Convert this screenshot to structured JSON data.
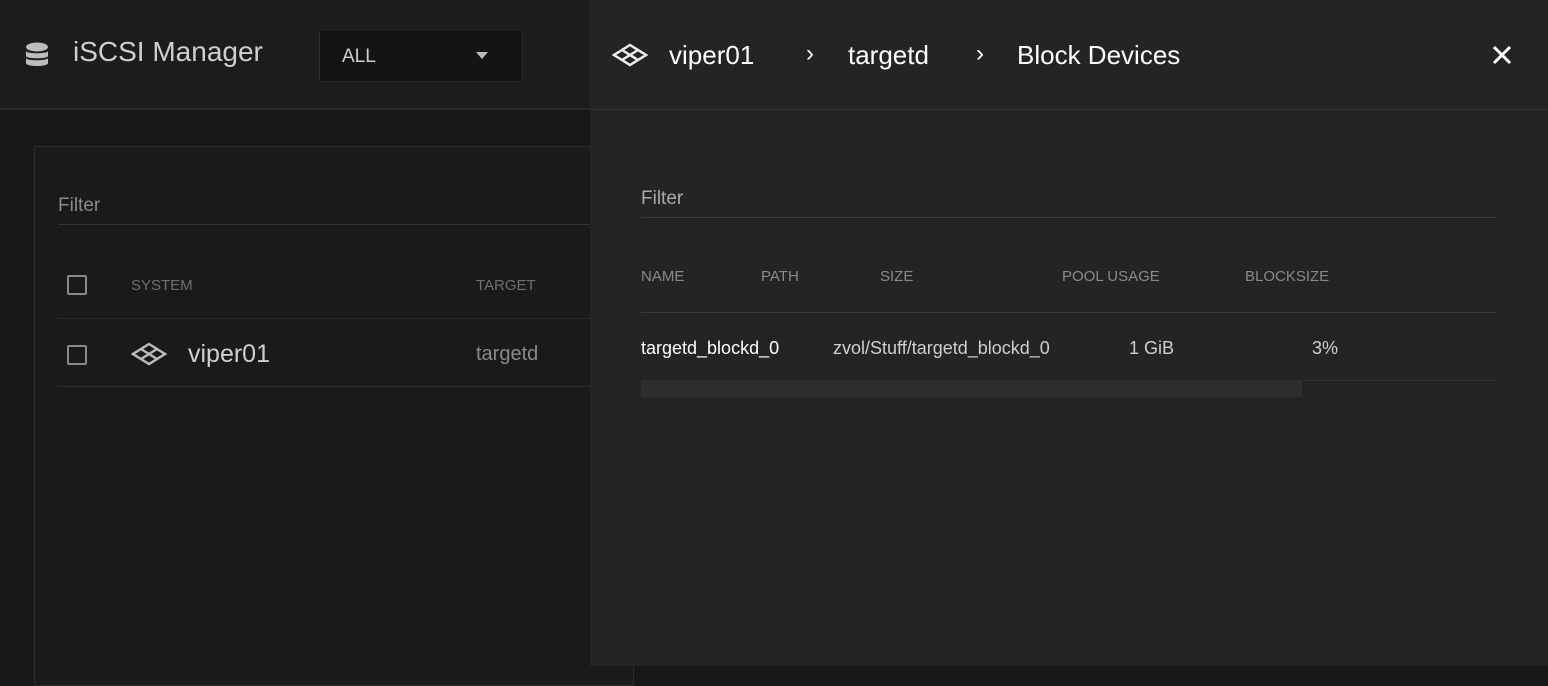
{
  "header": {
    "app_title": "iSCSI Manager",
    "app_icon": "database-icon",
    "system_select": {
      "value": "ALL"
    }
  },
  "list": {
    "filter_placeholder": "Filter",
    "columns": [
      "SYSTEM",
      "TARGET"
    ],
    "rows": [
      {
        "system": "viper01",
        "system_icon": "server-grid-icon",
        "target": "targetd"
      }
    ]
  },
  "panel": {
    "breadcrumb": [
      "viper01",
      "targetd",
      "Block Devices"
    ],
    "close_icon": "close-icon",
    "filter_placeholder": "Filter",
    "columns": [
      "NAME",
      "PATH",
      "SIZE",
      "POOL USAGE",
      "BLOCKSIZE"
    ],
    "rows": [
      {
        "name": "targetd_blockd_0",
        "path": "zvol/Stuff/targetd_blockd_0",
        "size": "1 GiB",
        "pool_usage": "3%",
        "blocksize": ""
      }
    ]
  }
}
